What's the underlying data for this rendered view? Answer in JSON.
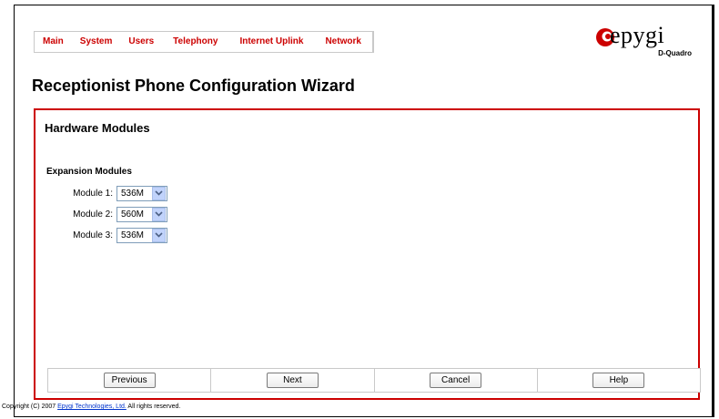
{
  "nav": {
    "items": [
      "Main",
      "System",
      "Users",
      "Telephony",
      "Internet Uplink",
      "Network"
    ]
  },
  "logo": {
    "text": "epygi",
    "subtitle": "D-Quadro",
    "brand_color": "#cc0000"
  },
  "page": {
    "title": "Receptionist Phone Configuration Wizard"
  },
  "panel": {
    "title": "Hardware Modules",
    "section_label": "Expansion Modules",
    "modules": [
      {
        "label": "Module 1:",
        "value": "536M"
      },
      {
        "label": "Module 2:",
        "value": "560M"
      },
      {
        "label": "Module 3:",
        "value": "536M"
      }
    ],
    "border_color": "#cc0000"
  },
  "buttons": {
    "previous": "Previous",
    "next": "Next",
    "cancel": "Cancel",
    "help": "Help"
  },
  "footer": {
    "prefix": "Copyright (C) 2007",
    "company_link": "Epygi Technologies, Ltd.",
    "suffix": "All rights reserved."
  }
}
